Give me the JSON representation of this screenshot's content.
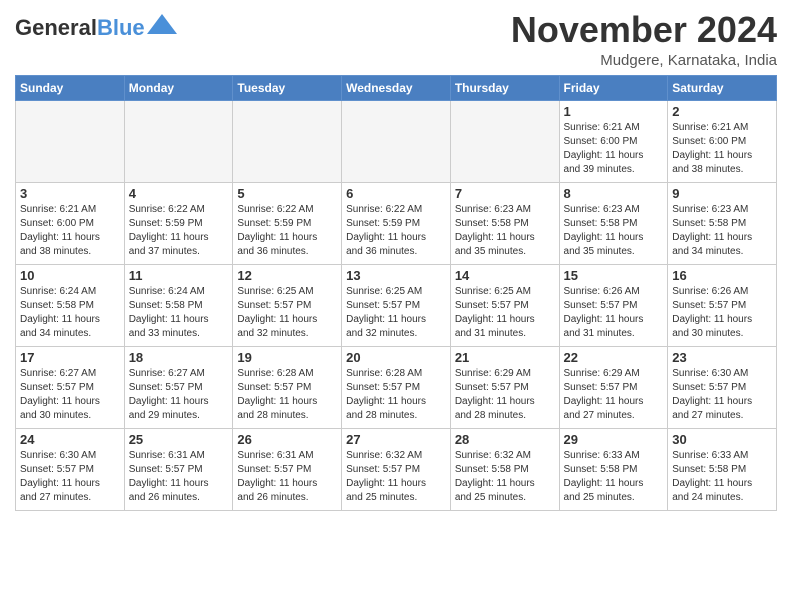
{
  "header": {
    "logo_line1": "General",
    "logo_line2": "Blue",
    "month": "November 2024",
    "location": "Mudgere, Karnataka, India"
  },
  "weekdays": [
    "Sunday",
    "Monday",
    "Tuesday",
    "Wednesday",
    "Thursday",
    "Friday",
    "Saturday"
  ],
  "weeks": [
    [
      {
        "day": "",
        "info": ""
      },
      {
        "day": "",
        "info": ""
      },
      {
        "day": "",
        "info": ""
      },
      {
        "day": "",
        "info": ""
      },
      {
        "day": "",
        "info": ""
      },
      {
        "day": "1",
        "info": "Sunrise: 6:21 AM\nSunset: 6:00 PM\nDaylight: 11 hours\nand 39 minutes."
      },
      {
        "day": "2",
        "info": "Sunrise: 6:21 AM\nSunset: 6:00 PM\nDaylight: 11 hours\nand 38 minutes."
      }
    ],
    [
      {
        "day": "3",
        "info": "Sunrise: 6:21 AM\nSunset: 6:00 PM\nDaylight: 11 hours\nand 38 minutes."
      },
      {
        "day": "4",
        "info": "Sunrise: 6:22 AM\nSunset: 5:59 PM\nDaylight: 11 hours\nand 37 minutes."
      },
      {
        "day": "5",
        "info": "Sunrise: 6:22 AM\nSunset: 5:59 PM\nDaylight: 11 hours\nand 36 minutes."
      },
      {
        "day": "6",
        "info": "Sunrise: 6:22 AM\nSunset: 5:59 PM\nDaylight: 11 hours\nand 36 minutes."
      },
      {
        "day": "7",
        "info": "Sunrise: 6:23 AM\nSunset: 5:58 PM\nDaylight: 11 hours\nand 35 minutes."
      },
      {
        "day": "8",
        "info": "Sunrise: 6:23 AM\nSunset: 5:58 PM\nDaylight: 11 hours\nand 35 minutes."
      },
      {
        "day": "9",
        "info": "Sunrise: 6:23 AM\nSunset: 5:58 PM\nDaylight: 11 hours\nand 34 minutes."
      }
    ],
    [
      {
        "day": "10",
        "info": "Sunrise: 6:24 AM\nSunset: 5:58 PM\nDaylight: 11 hours\nand 34 minutes."
      },
      {
        "day": "11",
        "info": "Sunrise: 6:24 AM\nSunset: 5:58 PM\nDaylight: 11 hours\nand 33 minutes."
      },
      {
        "day": "12",
        "info": "Sunrise: 6:25 AM\nSunset: 5:57 PM\nDaylight: 11 hours\nand 32 minutes."
      },
      {
        "day": "13",
        "info": "Sunrise: 6:25 AM\nSunset: 5:57 PM\nDaylight: 11 hours\nand 32 minutes."
      },
      {
        "day": "14",
        "info": "Sunrise: 6:25 AM\nSunset: 5:57 PM\nDaylight: 11 hours\nand 31 minutes."
      },
      {
        "day": "15",
        "info": "Sunrise: 6:26 AM\nSunset: 5:57 PM\nDaylight: 11 hours\nand 31 minutes."
      },
      {
        "day": "16",
        "info": "Sunrise: 6:26 AM\nSunset: 5:57 PM\nDaylight: 11 hours\nand 30 minutes."
      }
    ],
    [
      {
        "day": "17",
        "info": "Sunrise: 6:27 AM\nSunset: 5:57 PM\nDaylight: 11 hours\nand 30 minutes."
      },
      {
        "day": "18",
        "info": "Sunrise: 6:27 AM\nSunset: 5:57 PM\nDaylight: 11 hours\nand 29 minutes."
      },
      {
        "day": "19",
        "info": "Sunrise: 6:28 AM\nSunset: 5:57 PM\nDaylight: 11 hours\nand 28 minutes."
      },
      {
        "day": "20",
        "info": "Sunrise: 6:28 AM\nSunset: 5:57 PM\nDaylight: 11 hours\nand 28 minutes."
      },
      {
        "day": "21",
        "info": "Sunrise: 6:29 AM\nSunset: 5:57 PM\nDaylight: 11 hours\nand 28 minutes."
      },
      {
        "day": "22",
        "info": "Sunrise: 6:29 AM\nSunset: 5:57 PM\nDaylight: 11 hours\nand 27 minutes."
      },
      {
        "day": "23",
        "info": "Sunrise: 6:30 AM\nSunset: 5:57 PM\nDaylight: 11 hours\nand 27 minutes."
      }
    ],
    [
      {
        "day": "24",
        "info": "Sunrise: 6:30 AM\nSunset: 5:57 PM\nDaylight: 11 hours\nand 27 minutes."
      },
      {
        "day": "25",
        "info": "Sunrise: 6:31 AM\nSunset: 5:57 PM\nDaylight: 11 hours\nand 26 minutes."
      },
      {
        "day": "26",
        "info": "Sunrise: 6:31 AM\nSunset: 5:57 PM\nDaylight: 11 hours\nand 26 minutes."
      },
      {
        "day": "27",
        "info": "Sunrise: 6:32 AM\nSunset: 5:57 PM\nDaylight: 11 hours\nand 25 minutes."
      },
      {
        "day": "28",
        "info": "Sunrise: 6:32 AM\nSunset: 5:58 PM\nDaylight: 11 hours\nand 25 minutes."
      },
      {
        "day": "29",
        "info": "Sunrise: 6:33 AM\nSunset: 5:58 PM\nDaylight: 11 hours\nand 25 minutes."
      },
      {
        "day": "30",
        "info": "Sunrise: 6:33 AM\nSunset: 5:58 PM\nDaylight: 11 hours\nand 24 minutes."
      }
    ]
  ]
}
